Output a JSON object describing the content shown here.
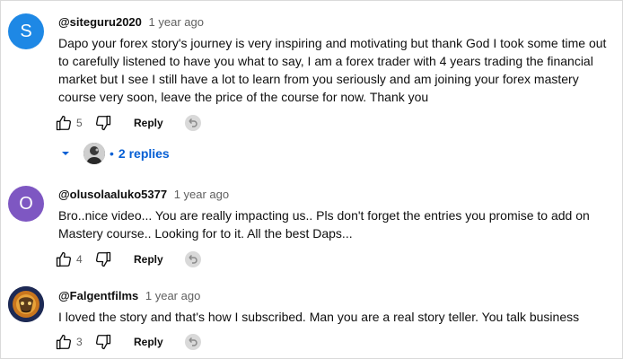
{
  "colors": {
    "accent": "#065fd4",
    "avatar_s": "#1e88e5",
    "avatar_o": "#7e57c2"
  },
  "comments": [
    {
      "avatar_letter": "S",
      "handle": "@siteguru2020",
      "time": "1 year ago",
      "text": "Dapo your forex story's journey is very inspiring and motivating but thank God I took some time out to carefully listened to have you what to say, I am a forex trader with 4 years trading the financial market but I see I still have a lot to learn from you seriously and am joining your forex mastery course very soon, leave the price of the course for now. Thank you",
      "likes": "5",
      "reply_label": "Reply",
      "replies_label": "2 replies"
    },
    {
      "avatar_letter": "O",
      "handle": "@olusolaaluko5377",
      "time": "1 year ago",
      "text": "Bro..nice video... You are really impacting us.. Pls don't forget the entries you promise to add on Mastery course.. Looking for to it. All the best Daps...",
      "likes": "4",
      "reply_label": "Reply"
    },
    {
      "avatar_letter": "",
      "handle": "@Falgentfilms",
      "time": "1 year ago",
      "text": "I loved the story and that's how I subscribed. Man you are a real story teller. You talk business",
      "likes": "3",
      "reply_label": "Reply"
    }
  ],
  "icons": {
    "like": "thumbs-up-icon",
    "dislike": "thumbs-down-icon",
    "creator_reply": "creator-reply-icon",
    "expand": "chevron-down-icon"
  },
  "replies_dot": "•"
}
